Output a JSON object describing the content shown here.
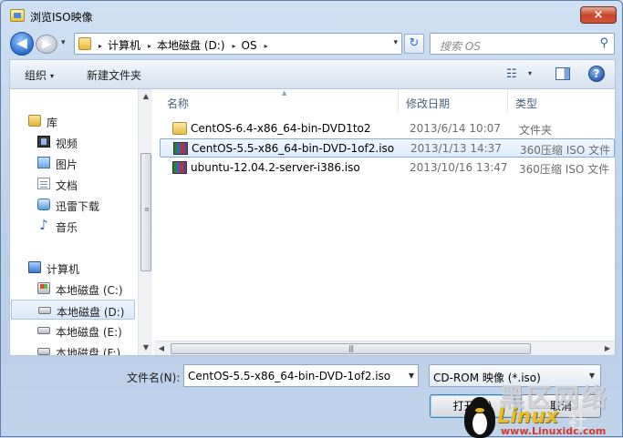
{
  "window": {
    "title": "浏览ISO映像",
    "close_glyph": "×"
  },
  "nav": {
    "back_glyph": "◀",
    "forward_glyph": "▶",
    "recent_glyph": "▾",
    "breadcrumb": [
      "计算机",
      "本地磁盘 (D:)",
      "OS"
    ],
    "breadcrumb_separator": "▸",
    "address_dropdown_glyph": "▾",
    "refresh_glyph": "↻",
    "search_placeholder": "搜索 OS",
    "search_icon": "search-icon"
  },
  "toolbar": {
    "organize_label": "组织",
    "new_folder_label": "新建文件夹",
    "caret_glyph": "▾",
    "view_glyph": "☷",
    "help_glyph": "?"
  },
  "sidebar": {
    "library": {
      "label": "库",
      "icon": "library-icon"
    },
    "library_items": [
      {
        "label": "视频",
        "icon": "video-icon"
      },
      {
        "label": "图片",
        "icon": "pictures-icon"
      },
      {
        "label": "文档",
        "icon": "documents-icon"
      },
      {
        "label": "迅雷下载",
        "icon": "download-icon"
      },
      {
        "label": "音乐",
        "icon": "music-icon"
      }
    ],
    "computer": {
      "label": "计算机",
      "icon": "computer-icon"
    },
    "drives": [
      {
        "label": "本地磁盘 (C:)",
        "icon": "system-drive-icon",
        "selected": false
      },
      {
        "label": "本地磁盘 (D:)",
        "icon": "drive-icon",
        "selected": true
      },
      {
        "label": "本地磁盘 (E:)",
        "icon": "drive-icon",
        "selected": false
      },
      {
        "label": "本地磁盘 (F:)",
        "icon": "drive-icon",
        "selected": false
      }
    ]
  },
  "file_list": {
    "columns": {
      "name": "名称",
      "modified": "修改日期",
      "type": "类型"
    },
    "rows": [
      {
        "name": "CentOS-6.4-x86_64-bin-DVD1to2",
        "modified": "2013/6/14 10:07",
        "type": "文件夹",
        "icon": "folder-icon",
        "selected": false
      },
      {
        "name": "CentOS-5.5-x86_64-bin-DVD-1of2.iso",
        "modified": "2013/1/13 14:37",
        "type": "360压缩 ISO 文件",
        "icon": "iso-archive-icon",
        "selected": true
      },
      {
        "name": "ubuntu-12.04.2-server-i386.iso",
        "modified": "2013/10/16 13:47",
        "type": "360压缩 ISO 文件",
        "icon": "iso-archive-icon",
        "selected": false
      }
    ]
  },
  "bottom": {
    "filename_label": "文件名(N):",
    "filename_value": "CentOS-5.5-x86_64-bin-DVD-1of2.iso",
    "filetype_value": "CD-ROM 映像 (*.iso)",
    "open_label": "打开(O)",
    "cancel_label": "取消"
  },
  "watermark": {
    "chinese": "黑区网络",
    "brand": "Linux",
    "suffix": "社",
    "url": "www.Linuxidc.com"
  }
}
